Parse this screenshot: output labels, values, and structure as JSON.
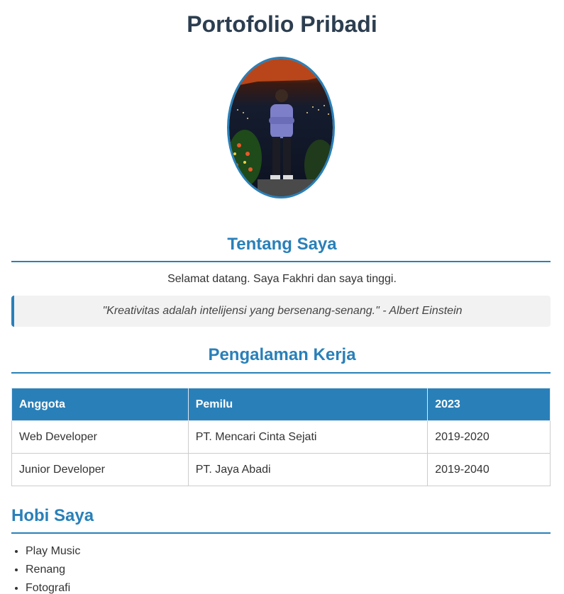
{
  "header": {
    "title": "Portofolio Pribadi"
  },
  "profile": {
    "photo_alt": "Foto profil"
  },
  "about": {
    "title": "Tentang Saya",
    "intro": "Selamat datang. Saya Fakhri dan saya tinggi.",
    "quote": "\"Kreativitas adalah intelijensi yang bersenang-senang.\" - Albert Einstein"
  },
  "experience": {
    "title": "Pengalaman Kerja",
    "headers": [
      "Anggota",
      "Pemilu",
      "2023"
    ],
    "rows": [
      [
        "Web Developer",
        "PT. Mencari Cinta Sejati",
        "2019-2020"
      ],
      [
        "Junior Developer",
        "PT. Jaya Abadi",
        "2019-2040"
      ]
    ]
  },
  "hobbies": {
    "title": "Hobi Saya",
    "items": [
      "Play Music",
      "Renang",
      "Fotografi"
    ]
  },
  "colors": {
    "accent": "#2980b9",
    "title": "#2c3e50",
    "quote_bg": "#f2f2f2"
  }
}
